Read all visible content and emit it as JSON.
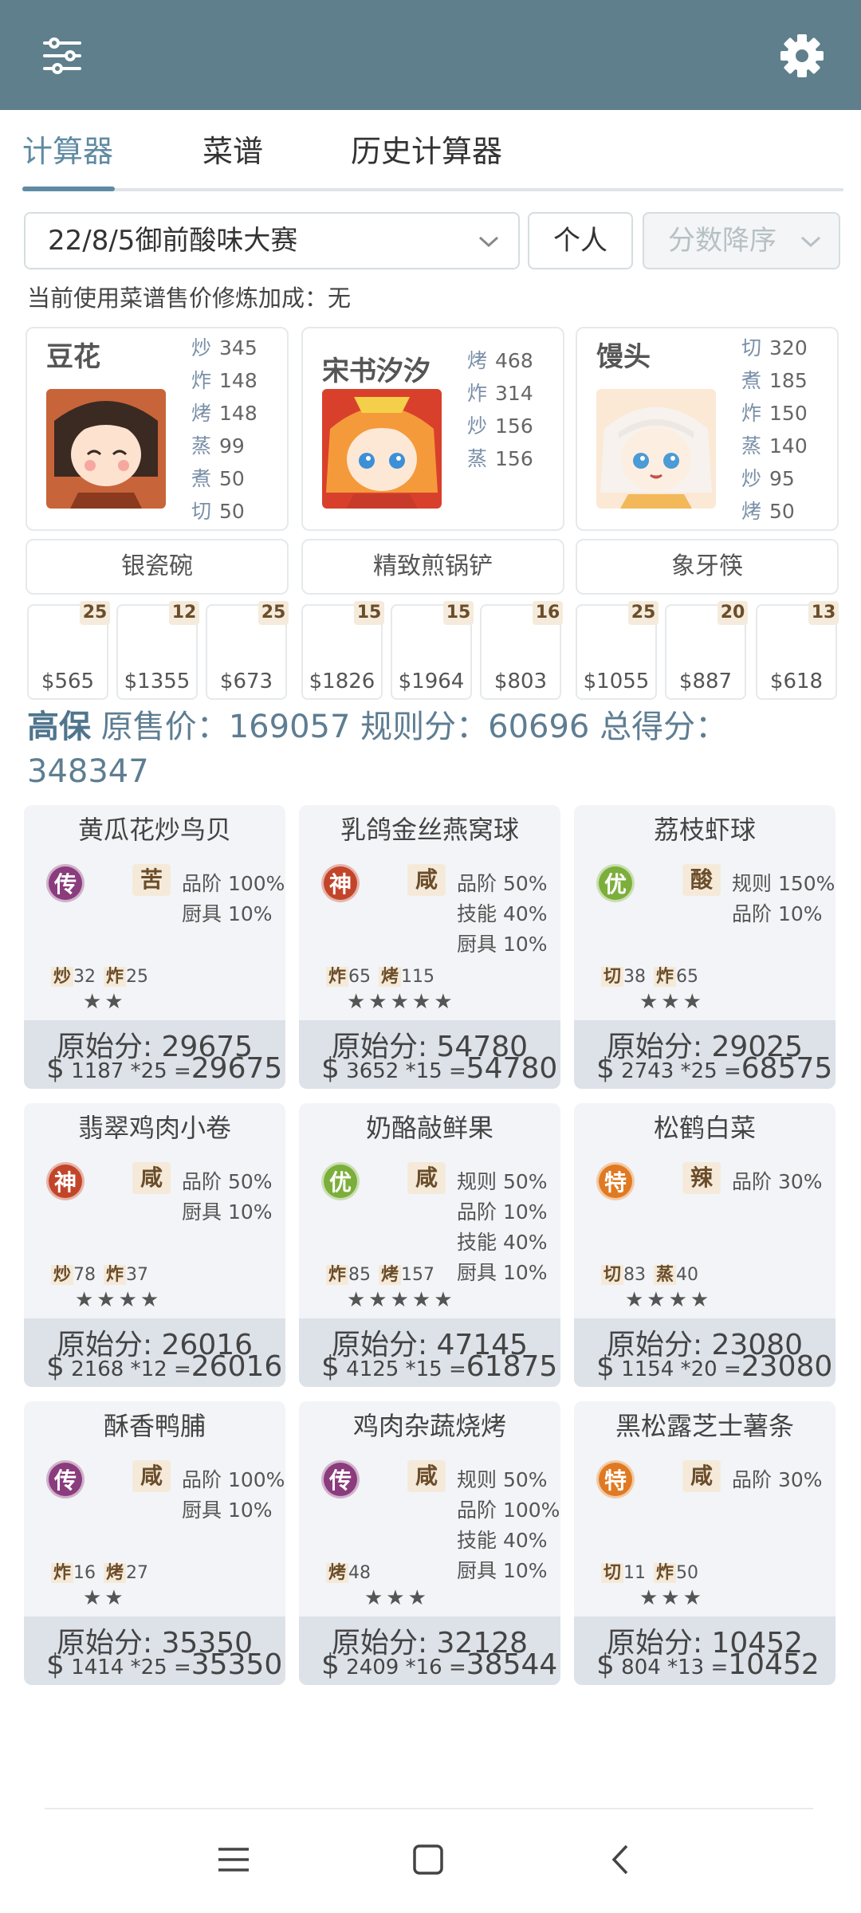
{
  "tabs": [
    "计算器",
    "菜谱",
    "历史计算器"
  ],
  "filters": {
    "contest": "22/8/5御前酸味大赛",
    "mode": "个人",
    "sort": "分数降序"
  },
  "info_line": "当前使用菜谱售价修炼加成：无",
  "chefs": [
    {
      "name": "豆花",
      "skills": [
        [
          "炒",
          "345"
        ],
        [
          "炸",
          "148"
        ],
        [
          "烤",
          "148"
        ],
        [
          "蒸",
          "99"
        ],
        [
          "煮",
          "50"
        ],
        [
          "切",
          "50"
        ]
      ],
      "equipment": "银瓷碗"
    },
    {
      "name": "宋书汐汐",
      "skills": [
        [
          "烤",
          "468"
        ],
        [
          "炸",
          "314"
        ],
        [
          "炒",
          "156"
        ],
        [
          "蒸",
          "156"
        ]
      ],
      "equipment": "精致煎锅铲"
    },
    {
      "name": "馒头",
      "skills": [
        [
          "切",
          "320"
        ],
        [
          "煮",
          "185"
        ],
        [
          "炸",
          "150"
        ],
        [
          "蒸",
          "140"
        ],
        [
          "炒",
          "95"
        ],
        [
          "烤",
          "50"
        ]
      ],
      "equipment": "象牙筷"
    }
  ],
  "materials": [
    {
      "qty": "25",
      "price": "$565"
    },
    {
      "qty": "12",
      "price": "$1355"
    },
    {
      "qty": "25",
      "price": "$673"
    },
    {
      "qty": "15",
      "price": "$1826"
    },
    {
      "qty": "15",
      "price": "$1964"
    },
    {
      "qty": "16",
      "price": "$803"
    },
    {
      "qty": "25",
      "price": "$1055"
    },
    {
      "qty": "20",
      "price": "$887"
    },
    {
      "qty": "13",
      "price": "$618"
    }
  ],
  "summary": {
    "label": "高保",
    "text_a": "原售价：169057 规则分：60696 总得分：",
    "text_b": "348347"
  },
  "dishes": [
    {
      "name": "黄瓜花炒鸟贝",
      "rank": "传",
      "rank_color": "#8a3c7d",
      "flavor": "苦",
      "bonuses": [
        "品阶 100%",
        "厨具 10%"
      ],
      "skills": [
        [
          "炒",
          "32"
        ],
        [
          "炸",
          "25"
        ]
      ],
      "stars": "★★",
      "orig": "原始分: 29675",
      "price": "1187",
      "mult": "*25",
      "eq": "=",
      "total": "29675"
    },
    {
      "name": "乳鸽金丝燕窝球",
      "rank": "神",
      "rank_color": "#c2452a",
      "flavor": "咸",
      "bonuses": [
        "品阶 50%",
        "技能 40%",
        "厨具 10%"
      ],
      "skills": [
        [
          "炸",
          "65"
        ],
        [
          "烤",
          "115"
        ]
      ],
      "stars": "★★★★★",
      "orig": "原始分: 54780",
      "price": "3652",
      "mult": "*15",
      "eq": "=",
      "total": "54780"
    },
    {
      "name": "荔枝虾球",
      "rank": "优",
      "rank_color": "#7cae3b",
      "flavor": "酸",
      "bonuses": [
        "规则 150%",
        "品阶 10%"
      ],
      "skills": [
        [
          "切",
          "38"
        ],
        [
          "炸",
          "65"
        ]
      ],
      "stars": "★★★",
      "orig": "原始分: 29025",
      "price": "2743",
      "mult": "*25",
      "eq": "=",
      "total": "68575"
    },
    {
      "name": "翡翠鸡肉小卷",
      "rank": "神",
      "rank_color": "#c2452a",
      "flavor": "咸",
      "bonuses": [
        "品阶 50%",
        "厨具 10%"
      ],
      "skills": [
        [
          "炒",
          "78"
        ],
        [
          "炸",
          "37"
        ]
      ],
      "stars": "★★★★",
      "orig": "原始分: 26016",
      "price": "2168",
      "mult": "*12",
      "eq": "=",
      "total": "26016"
    },
    {
      "name": "奶酪敲鲜果",
      "rank": "优",
      "rank_color": "#7cae3b",
      "flavor": "咸",
      "bonuses": [
        "规则 50%",
        "品阶 10%",
        "技能 40%",
        "厨具 10%"
      ],
      "skills": [
        [
          "炸",
          "85"
        ],
        [
          "烤",
          "157"
        ]
      ],
      "stars": "★★★★★",
      "orig": "原始分: 47145",
      "price": "4125",
      "mult": "*15",
      "eq": "=",
      "total": "61875"
    },
    {
      "name": "松鹤白菜",
      "rank": "特",
      "rank_color": "#e07a22",
      "flavor": "辣",
      "bonuses": [
        "品阶 30%"
      ],
      "skills": [
        [
          "切",
          "83"
        ],
        [
          "蒸",
          "40"
        ]
      ],
      "stars": "★★★★",
      "orig": "原始分: 23080",
      "price": "1154",
      "mult": "*20",
      "eq": "=",
      "total": "23080"
    },
    {
      "name": "酥香鸭脯",
      "rank": "传",
      "rank_color": "#8a3c7d",
      "flavor": "咸",
      "bonuses": [
        "品阶 100%",
        "厨具 10%"
      ],
      "skills": [
        [
          "炸",
          "16"
        ],
        [
          "烤",
          "27"
        ]
      ],
      "stars": "★★",
      "orig": "原始分: 35350",
      "price": "1414",
      "mult": "*25",
      "eq": "=",
      "total": "35350"
    },
    {
      "name": "鸡肉杂蔬烧烤",
      "rank": "传",
      "rank_color": "#8a3c7d",
      "flavor": "咸",
      "bonuses": [
        "规则 50%",
        "品阶 100%",
        "技能 40%",
        "厨具 10%"
      ],
      "skills": [
        [
          "烤",
          "48"
        ]
      ],
      "stars": "★★★",
      "orig": "原始分: 32128",
      "price": "2409",
      "mult": "*16",
      "eq": "=",
      "total": "38544"
    },
    {
      "name": "黑松露芝士薯条",
      "rank": "特",
      "rank_color": "#e07a22",
      "flavor": "咸",
      "bonuses": [
        "品阶 30%"
      ],
      "skills": [
        [
          "切",
          "11"
        ],
        [
          "炸",
          "50"
        ]
      ],
      "stars": "★★★",
      "orig": "原始分: 10452",
      "price": "804",
      "mult": "*13",
      "eq": "=",
      "total": "10452"
    }
  ],
  "colors": {
    "topbar": "#5f7f8c",
    "accent": "#5f8aa3"
  },
  "icons": {
    "left": "sliders-icon",
    "right": "gear-icon",
    "nav": [
      "menu-icon",
      "home-square-icon",
      "back-icon"
    ]
  }
}
